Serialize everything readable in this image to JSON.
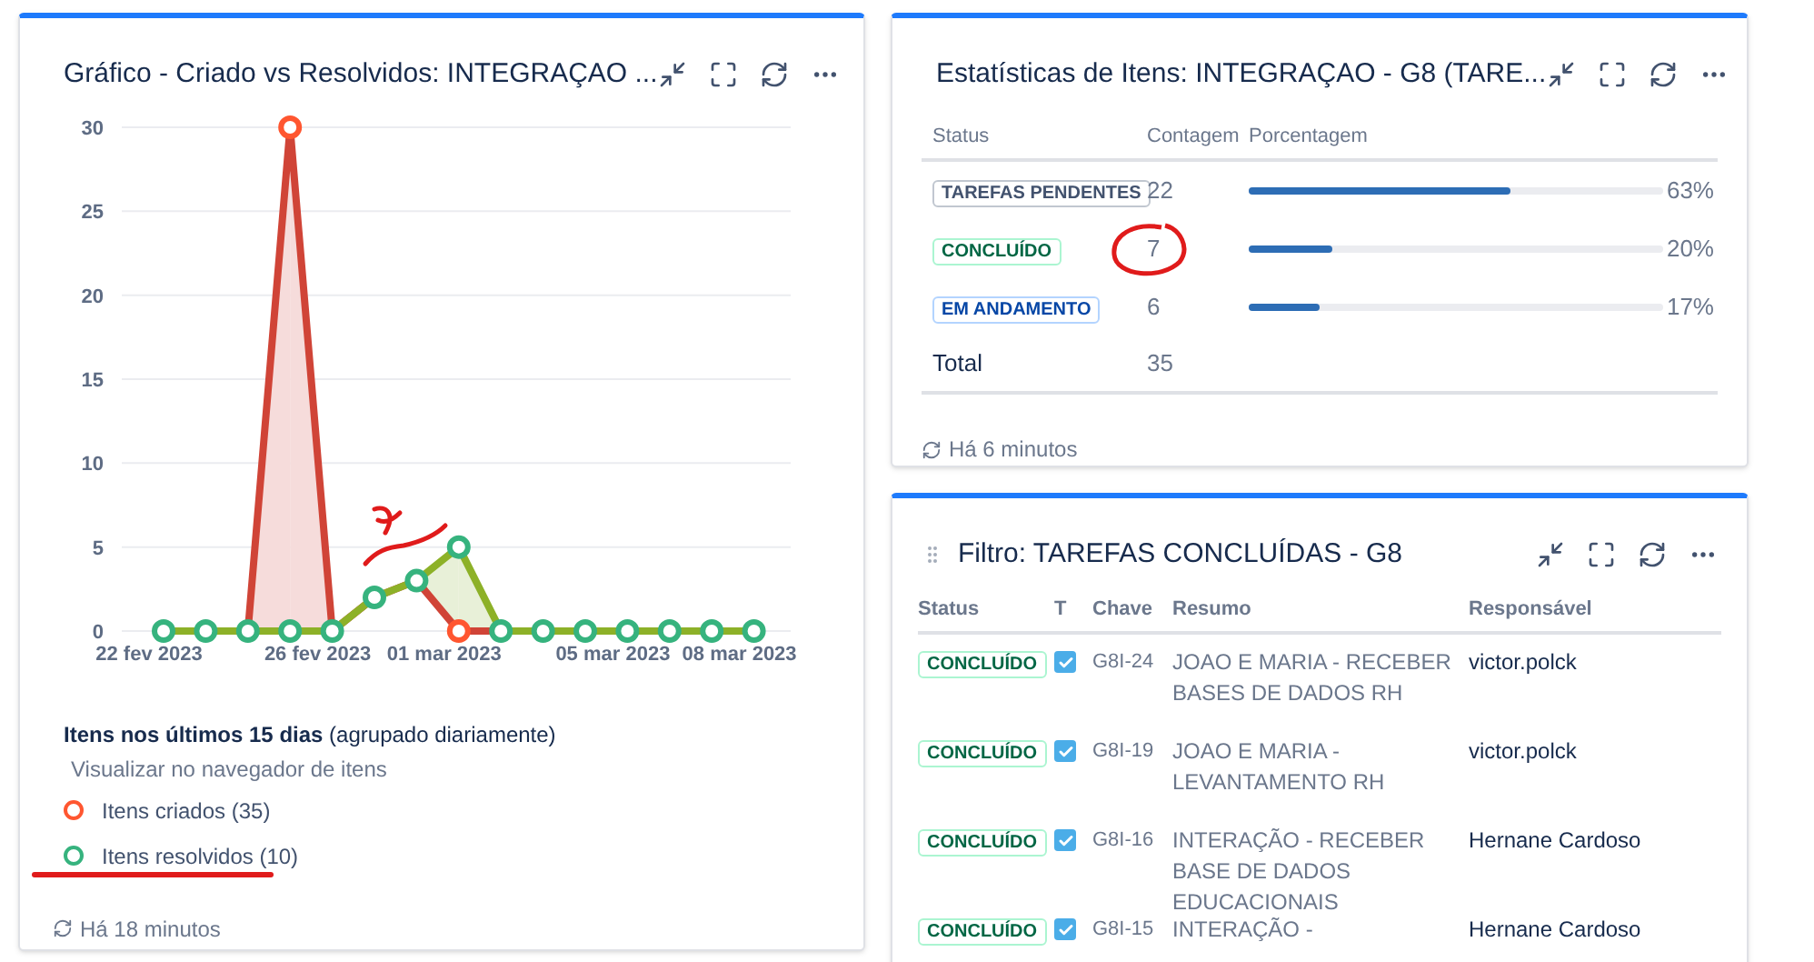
{
  "created_vs_resolved": {
    "title": "Gráfico - Criado vs Resolvidos: INTEGRAÇAO ...",
    "chart_data": {
      "type": "line",
      "categories": [
        "22 fev 2023",
        null,
        null,
        null,
        "26 fev 2023",
        null,
        null,
        "01 mar 2023",
        null,
        null,
        null,
        "05 mar 2023",
        null,
        null,
        "08 mar 2023"
      ],
      "ylim": [
        0,
        30
      ],
      "yticks": [
        0,
        5,
        10,
        15,
        20,
        25,
        30
      ],
      "grid": true,
      "series": [
        {
          "name": "Itens criados",
          "color": "#d04437",
          "marker": "circle",
          "values": [
            null,
            null,
            0,
            30,
            0,
            2,
            3,
            0,
            0,
            null,
            null,
            null,
            null,
            null,
            null
          ]
        },
        {
          "name": "Itens resolvidos",
          "color": "#8db128",
          "marker": "circle",
          "values": [
            0,
            0,
            0,
            0,
            0,
            2,
            3,
            5,
            0,
            0,
            0,
            0,
            0,
            0,
            0
          ]
        }
      ]
    },
    "summary": "**Itens nos últimos 15 dias** (agrupado diariamente)",
    "link": "Visualizar no navegador de itens",
    "legend": [
      {
        "count": "(35)",
        "color": "#ff5630"
      },
      {
        "count": "(10)",
        "color": "#36b37e"
      }
    ],
    "updated": "Há 18 minutos"
  },
  "statistics": {
    "title": "Estatísticas de Itens: INTEGRAÇAO - G8 (TARE...",
    "columns": [
      "Status",
      "Contagem",
      "Porcentagem"
    ],
    "rows": [
      {
        "status": "TAREFAS PENDENTES",
        "kind": "todo",
        "count": "22",
        "level": 0.63,
        "percent": "63%"
      },
      {
        "status": "CONCLUÍDO",
        "kind": "done",
        "count": "7",
        "level": 0.2,
        "percent": "20%"
      },
      {
        "status": "EM ANDAMENTO",
        "kind": "progress",
        "count": "6",
        "level": 0.17,
        "percent": "17%"
      }
    ],
    "total_label": "Total",
    "total": "35",
    "updated": "Há 6 minutos"
  },
  "filter": {
    "title": "Filtro: TAREFAS CONCLUÍDAS - G8",
    "columns": [
      "Status",
      "T",
      "Chave",
      "Resumo",
      "Responsável"
    ],
    "rows": [
      {
        "status": "CONCLUÍDO",
        "kind": "done",
        "key": "G8I-24",
        "summary": "JOAO E MARIA - RECEBER BASES DE DADOS RH",
        "assignee": "victor.polck"
      },
      {
        "status": "CONCLUÍDO",
        "kind": "done",
        "key": "G8I-19",
        "summary": "JOAO E MARIA - LEVANTAMENTO RH",
        "assignee": "victor.polck"
      },
      {
        "status": "CONCLUÍDO",
        "kind": "done",
        "key": "G8I-16",
        "summary": "INTERAÇÃO - RECEBER BASE DE DADOS EDUCACIONAIS",
        "assignee": "Hernane Cardoso"
      },
      {
        "status": "CONCLUÍDO",
        "kind": "done",
        "key": "G8I-15",
        "summary": "INTERAÇÃO -",
        "assignee": "Hernane Cardoso"
      }
    ]
  }
}
